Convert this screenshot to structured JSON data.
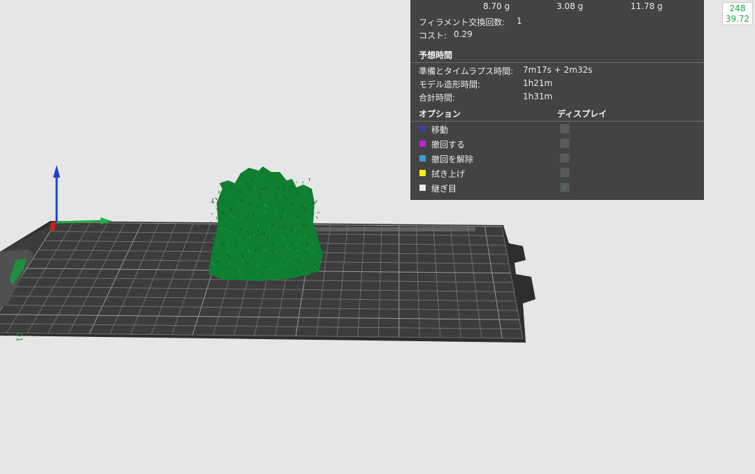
{
  "summary_weights": [
    "8.70 g",
    "3.08 g",
    "11.78 g"
  ],
  "filament_changes": {
    "label": "フィラメント交換回数:",
    "value": "1"
  },
  "cost": {
    "label": "コスト:",
    "value": "0.29"
  },
  "estimated_time": {
    "heading": "予想時間",
    "rows": [
      {
        "label": "準備とタイムラプス時間:",
        "value": "7m17s + 2m32s"
      },
      {
        "label": "モデル造形時間:",
        "value": "1h21m"
      },
      {
        "label": "合計時間:",
        "value": "1h31m"
      }
    ]
  },
  "options": {
    "heading_option": "オプション",
    "heading_display": "ディスプレイ",
    "items": [
      {
        "label": "移動",
        "color": "#3b3f9c",
        "checked": false
      },
      {
        "label": "撤回する",
        "color": "#c71ed4",
        "checked": false
      },
      {
        "label": "撤回を解除",
        "color": "#3aa0c8",
        "checked": false
      },
      {
        "label": "拭き上げ",
        "color": "#f7f00e",
        "checked": false
      },
      {
        "label": "継ぎ目",
        "color": "#e8e8e8",
        "checked": true
      }
    ]
  },
  "fps": {
    "frames": "248",
    "ms": "39.72"
  },
  "plate_label": "01",
  "colors": {
    "model": "#0f7f32",
    "plate": "#3a3a3a",
    "panel": "#434343",
    "accent": "#19a04a"
  }
}
